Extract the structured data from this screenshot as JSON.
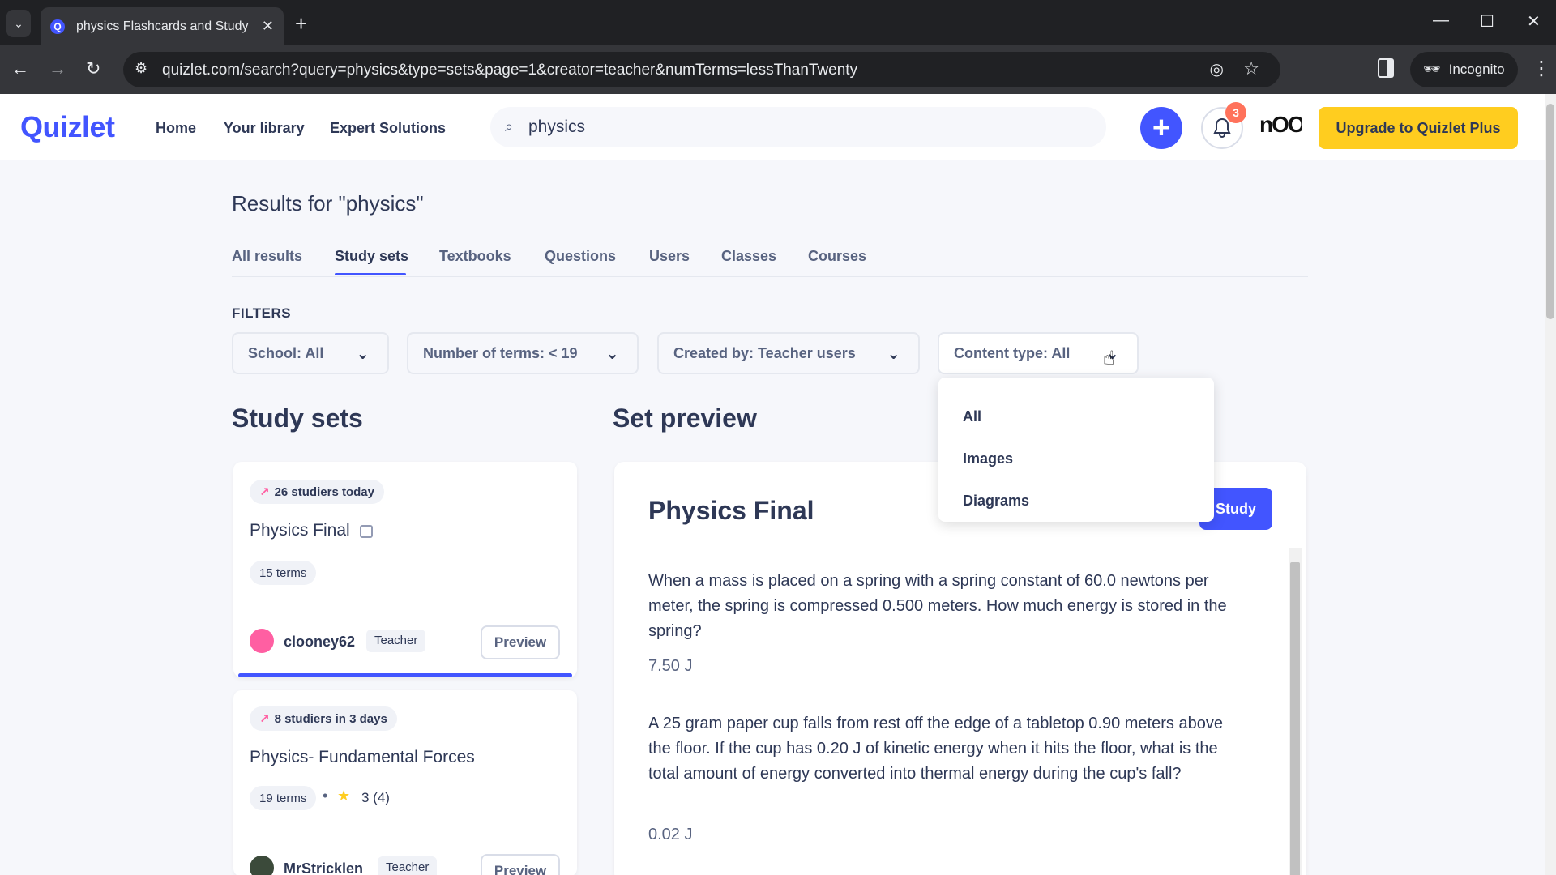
{
  "browser": {
    "tab_title": "physics Flashcards and Study Sets",
    "tab_list_icon": "chevron-down-icon",
    "url": "quizlet.com/search?query=physics&type=sets&page=1&creator=teacher&numTerms=lessThanTwenty",
    "incognito_label": "Incognito"
  },
  "header": {
    "logo": "Quizlet",
    "nav": [
      "Home",
      "Your library",
      "Expert Solutions"
    ],
    "search_value": "physics",
    "notification_count": "3",
    "avatar_text": "nOO",
    "upgrade_label": "Upgrade to Quizlet Plus",
    "colors": {
      "brand": "#4255ff",
      "upgrade": "#ffcd1f",
      "badge": "#ff725b"
    }
  },
  "results": {
    "title": "Results for \"physics\"",
    "tabs": [
      "All results",
      "Study sets",
      "Textbooks",
      "Questions",
      "Users",
      "Classes",
      "Courses"
    ],
    "active_tab": "Study sets"
  },
  "filters": {
    "label": "FILTERS",
    "school": "School: All",
    "num_terms": "Number of terms: < 19",
    "created_by": "Created by: Teacher users",
    "content_type": "Content type: All",
    "content_type_options": [
      "All",
      "Images",
      "Diagrams"
    ]
  },
  "study_sets": {
    "heading": "Study sets",
    "cards": [
      {
        "studiers": "26 studiers today",
        "title": "Physics Final",
        "terms": "15 terms",
        "user": "clooney62",
        "role": "Teacher",
        "preview_label": "Preview"
      },
      {
        "studiers": "8 studiers in 3 days",
        "title": "Physics- Fundamental Forces",
        "terms": "19 terms",
        "rating": "3 (4)",
        "user": "MrStricklen",
        "role": "Teacher",
        "preview_label": "Preview"
      }
    ]
  },
  "set_preview": {
    "heading": "Set preview",
    "title": "Physics Final",
    "study_label": "Study",
    "items": [
      {
        "term": "When a mass is placed on a spring with a spring constant of 60.0 newtons per meter, the spring is compressed 0.500 meters. How much energy is stored in the spring?",
        "definition": "7.50 J"
      },
      {
        "term": "A 25 gram paper cup falls from rest off the edge of a tabletop 0.90 meters above the floor. If the cup has 0.20 J of kinetic energy when it hits the floor, what is the total amount of energy converted into thermal energy during the cup's fall?",
        "definition": "0.02 J"
      }
    ]
  }
}
